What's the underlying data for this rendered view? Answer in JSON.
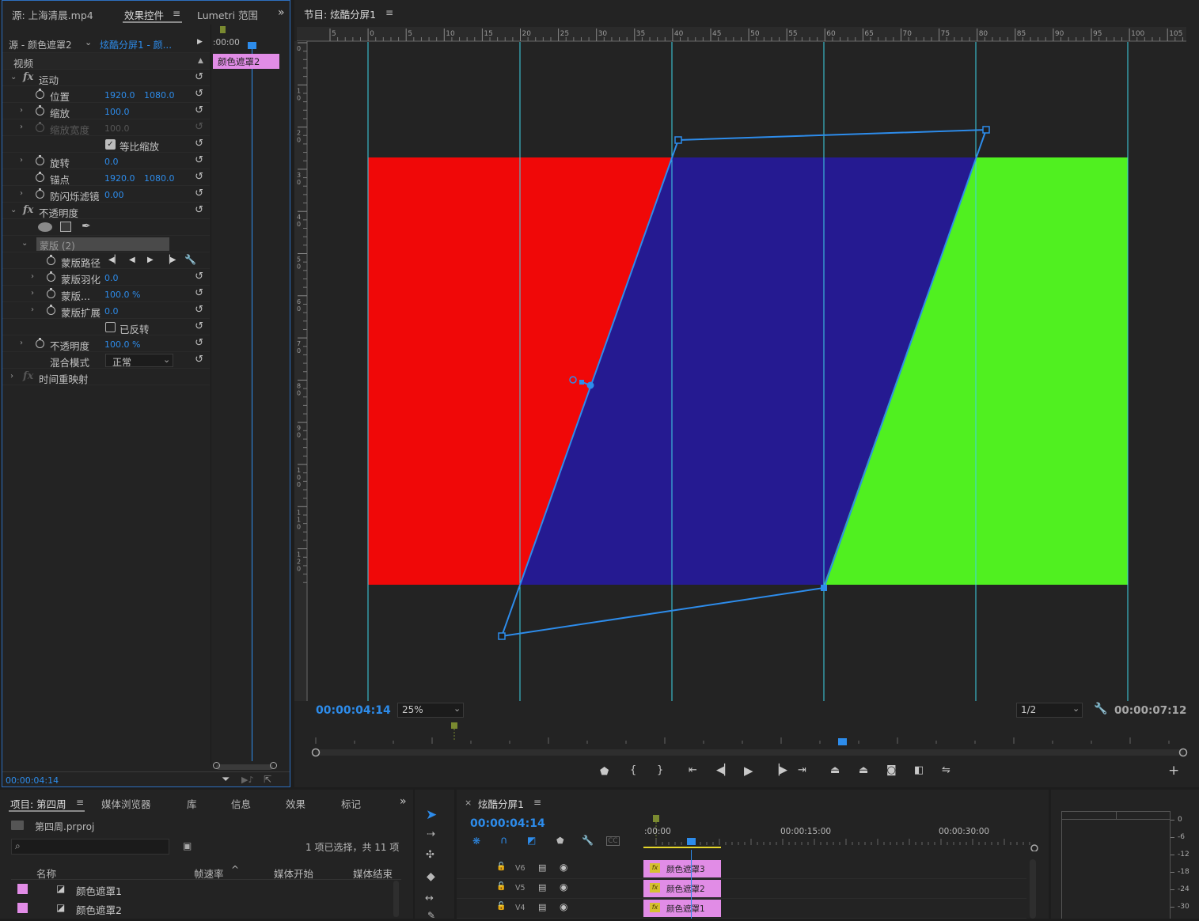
{
  "effects": {
    "tabs": {
      "source": "源: 上海清晨.mp4",
      "effect_controls": "效果控件",
      "lumetri": "Lumetri 范围"
    },
    "clip_selector": {
      "source": "源 - 颜色遮罩2",
      "sequence": "炫酷分屏1 - 颜..."
    },
    "mini_timeline": {
      "start_tc": ":00:00",
      "clip_label": "颜色遮罩2"
    },
    "section_video": "视频",
    "motion": {
      "title": "运动",
      "position": {
        "label": "位置",
        "x": "1920.0",
        "y": "1080.0"
      },
      "scale": {
        "label": "缩放",
        "value": "100.0"
      },
      "scale_width": {
        "label": "缩放宽度",
        "value": "100.0"
      },
      "uniform_scale": "等比缩放",
      "rotation": {
        "label": "旋转",
        "value": "0.0"
      },
      "anchor": {
        "label": "锚点",
        "x": "1920.0",
        "y": "1080.0"
      },
      "antiflicker": {
        "label": "防闪烁滤镜",
        "value": "0.00"
      }
    },
    "opacity": {
      "title": "不透明度",
      "mask_name": "蒙版 (2)",
      "mask_path": "蒙版路径",
      "mask_feather": {
        "label": "蒙版羽化",
        "value": "0.0"
      },
      "mask_opacity": {
        "label": "蒙版...",
        "value": "100.0 %"
      },
      "mask_expansion": {
        "label": "蒙版扩展",
        "value": "0.0"
      },
      "inverted": "已反转",
      "opacity": {
        "label": "不透明度",
        "value": "100.0 %"
      },
      "blend_mode": {
        "label": "混合模式",
        "value": "正常"
      }
    },
    "time_remap": "时间重映射",
    "timecode": "00:00:04:14"
  },
  "program": {
    "title": "节目: 炫酷分屏1",
    "ruler_labels": [
      "5",
      "0",
      "5",
      "10",
      "15",
      "20",
      "25",
      "30",
      "35",
      "40",
      "45",
      "50",
      "55",
      "60",
      "65",
      "70",
      "75",
      "80",
      "85",
      "90",
      "95",
      "100",
      "105"
    ],
    "left_ruler_labels": [
      "0",
      "1 0",
      "2 0",
      "3 0",
      "4 0",
      "5 0",
      "6 0",
      "7 0",
      "8 0",
      "9 0",
      "1 0 0",
      "1 1 0",
      "1 2 0"
    ],
    "current_tc": "00:00:04:14",
    "zoom": "25%",
    "resolution": "1/2",
    "duration_tc": "00:00:07:12",
    "colors": {
      "left": "#f00808",
      "middle": "#251a91",
      "right": "#50f020",
      "guide": "#3ed6e8",
      "mask": "#2d8ceb"
    }
  },
  "project": {
    "tabs": [
      "项目: 第四周",
      "媒体浏览器",
      "库",
      "信息",
      "效果",
      "标记"
    ],
    "file": "第四周.prproj",
    "selection_info": "1 项已选择，共 11 项",
    "columns": [
      "名称",
      "帧速率",
      "媒体开始",
      "媒体结束"
    ],
    "items": [
      "颜色遮罩1",
      "颜色遮罩2"
    ]
  },
  "timeline": {
    "title": "炫酷分屏1",
    "timecode": "00:00:04:14",
    "ruler": [
      ":00:00",
      "00:00:15:00",
      "00:00:30:00"
    ],
    "tracks": [
      {
        "name": "V6",
        "clip": "颜色遮罩3"
      },
      {
        "name": "V5",
        "clip": "颜色遮罩2"
      },
      {
        "name": "V4",
        "clip": "颜色遮罩1"
      }
    ]
  },
  "meter": {
    "labels": [
      "0",
      "-6",
      "-12",
      "-18",
      "-24",
      "-30"
    ]
  }
}
